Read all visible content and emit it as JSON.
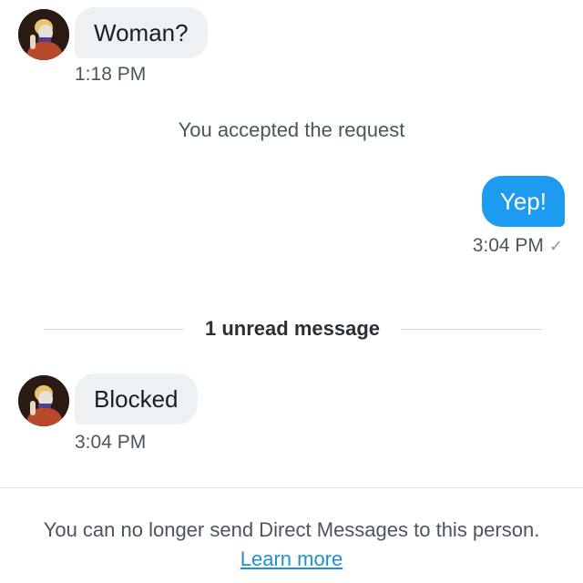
{
  "conversation": {
    "messages": [
      {
        "direction": "incoming",
        "avatar_icon": "profile-avatar",
        "text": "Woman?",
        "time": "1:18 PM"
      },
      {
        "direction": "outgoing",
        "text": "Yep!",
        "time": "3:04 PM",
        "status_icon": "sent-check-icon"
      },
      {
        "direction": "incoming",
        "avatar_icon": "profile-avatar",
        "text": "Blocked",
        "time": "3:04 PM"
      }
    ],
    "system_note": "You accepted the request",
    "unread_divider": "1 unread message"
  },
  "footer": {
    "notice": "You can no longer send Direct Messages to this person.",
    "link_label": "Learn more"
  },
  "colors": {
    "incoming_bubble": "#eef1f4",
    "outgoing_bubble": "#1d9bf0",
    "link": "#1d8fd8"
  }
}
